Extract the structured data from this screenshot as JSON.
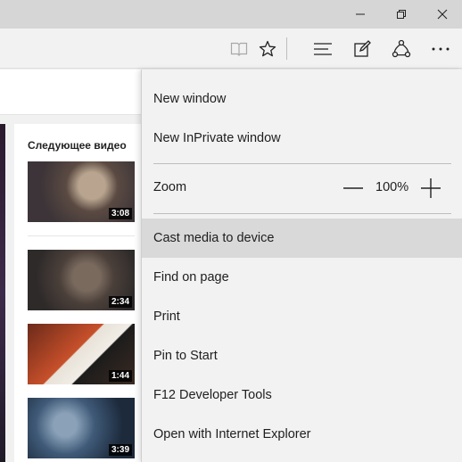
{
  "window": {
    "controls": [
      {
        "name": "minimize",
        "icon": "minimize-icon"
      },
      {
        "name": "restore",
        "icon": "restore-icon"
      },
      {
        "name": "close",
        "icon": "close-icon"
      }
    ]
  },
  "toolbar": {
    "buttons": [
      "reading-view-icon",
      "favorites-star-icon",
      "hub-icon",
      "web-note-icon",
      "share-icon",
      "more-icon"
    ]
  },
  "sidebar": {
    "title": "Следующее видео",
    "videos": [
      {
        "duration": "3:08"
      },
      {
        "duration": "2:34"
      },
      {
        "duration": "1:44"
      },
      {
        "duration": "3:39"
      }
    ]
  },
  "menu": {
    "new_window": "New window",
    "new_inprivate": "New InPrivate window",
    "zoom_label": "Zoom",
    "zoom_value": "100%",
    "cast": "Cast media to device",
    "find": "Find on page",
    "print": "Print",
    "pin": "Pin to Start",
    "devtools": "F12 Developer Tools",
    "open_ie": "Open with Internet Explorer",
    "highlighted_item": "Cast media to device"
  },
  "colors": {
    "titlebar": "#d6d6d6",
    "toolbar": "#f2f2f2",
    "menu_background": "#f2f2f2",
    "menu_highlight": "#d9d9d9"
  }
}
